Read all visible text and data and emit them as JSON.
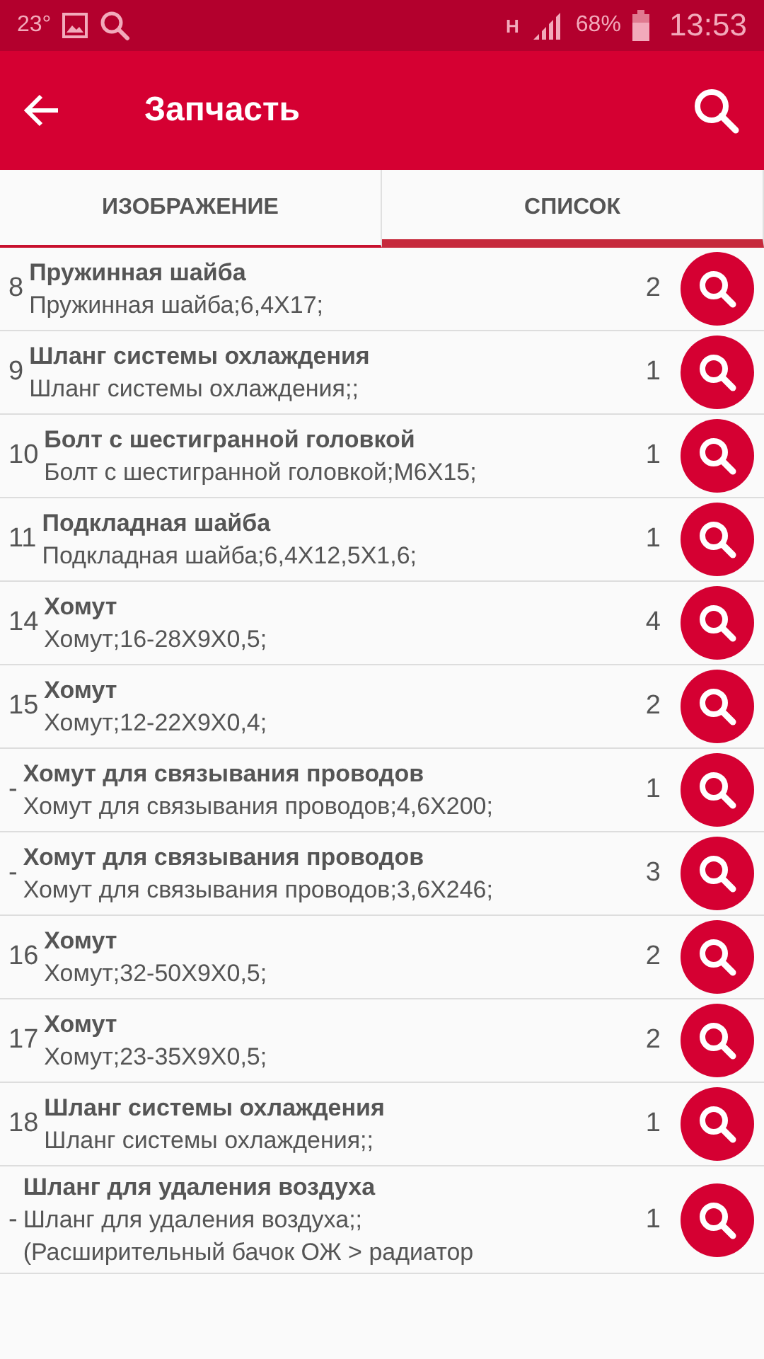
{
  "status_bar": {
    "temperature": "23°",
    "network": "H",
    "battery": "68%",
    "time": "13:53"
  },
  "app_bar": {
    "title": "Запчасть"
  },
  "tabs": [
    {
      "label": "ИЗОБРАЖЕНИЕ",
      "selected": false
    },
    {
      "label": "СПИСОК",
      "selected": true
    }
  ],
  "items": [
    {
      "number": "8",
      "name": "Пружинная шайба",
      "description": "Пружинная шайба;6,4X17;",
      "quantity": "2"
    },
    {
      "number": "9",
      "name": "Шланг системы охлаждения",
      "description": "Шланг системы охлаждения;;",
      "quantity": "1"
    },
    {
      "number": "10",
      "name": "Болт с шестигранной головкой",
      "description": "Болт с шестигранной головкой;M6X15;",
      "quantity": "1"
    },
    {
      "number": "11",
      "name": "Подкладная шайба",
      "description": "Подкладная шайба;6,4X12,5X1,6;",
      "quantity": "1"
    },
    {
      "number": "14",
      "name": "Хомут",
      "description": "Хомут;16-28X9X0,5;",
      "quantity": "4"
    },
    {
      "number": "15",
      "name": "Хомут",
      "description": "Хомут;12-22X9X0,4;",
      "quantity": "2"
    },
    {
      "number": "-",
      "name": "Хомут для связывания проводов",
      "description": "Хомут для связывания проводов;4,6X200;",
      "quantity": "1"
    },
    {
      "number": "-",
      "name": "Хомут для связывания проводов",
      "description": "Хомут для связывания проводов;3,6X246;",
      "quantity": "3"
    },
    {
      "number": "16",
      "name": "Хомут",
      "description": "Хомут;32-50X9X0,5;",
      "quantity": "2"
    },
    {
      "number": "17",
      "name": "Хомут",
      "description": "Хомут;23-35X9X0,5;",
      "quantity": "2"
    },
    {
      "number": "18",
      "name": "Шланг системы охлаждения",
      "description": "Шланг системы охлаждения;;",
      "quantity": "1"
    },
    {
      "number": "-",
      "name": "Шланг для удаления воздуха",
      "description": "Шланг для удаления воздуха;; (Расширительный бачок ОЖ > радиатор",
      "quantity": "1"
    }
  ]
}
